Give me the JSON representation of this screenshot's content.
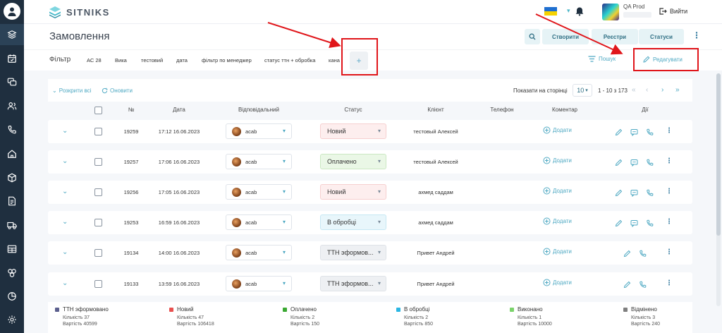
{
  "app": {
    "logo_text": "SITNIKS",
    "page_title": "Замовлення"
  },
  "user": {
    "name": "QA Prod",
    "logout_label": "Вийти"
  },
  "header_buttons": {
    "create": "Створити",
    "registers": "Реєстри",
    "statuses": "Статуси"
  },
  "filter": {
    "label": "Фільтр",
    "chips": [
      "АС 28",
      "Вика",
      "тестовий",
      "дата",
      "фільтр по менеджер",
      "статус ттн + обробка",
      "кана"
    ],
    "add_label": "+",
    "search_label": "Пошук",
    "edit_label": "Редагувати"
  },
  "toolbar": {
    "expand_all": "Розкрити всі",
    "refresh": "Оновити",
    "per_page_label": "Показати на сторінці",
    "per_page_value": "10",
    "range": "1 - 10 з 173"
  },
  "columns": {
    "number": "№",
    "date": "Дата",
    "responsible": "Відповідальний",
    "status": "Статус",
    "client": "Клієнт",
    "phone": "Телефон",
    "comment": "Коментар",
    "actions": "Дії"
  },
  "comment_add_label": "Додати",
  "rows": [
    {
      "id": "19259",
      "date": "17:12 16.06.2023",
      "responsible": "acab",
      "status": "Новий",
      "status_bg": "#fdeeee",
      "status_border": "#f6cfcf",
      "client": "тестовый Алексей",
      "has_chat": true
    },
    {
      "id": "19257",
      "date": "17:06 16.06.2023",
      "responsible": "acab",
      "status": "Оплачено",
      "status_bg": "#eaf7e6",
      "status_border": "#cbe8c3",
      "client": "тестовый Алексей",
      "has_chat": true
    },
    {
      "id": "19256",
      "date": "17:05 16.06.2023",
      "responsible": "acab",
      "status": "Новий",
      "status_bg": "#fdeeee",
      "status_border": "#f6cfcf",
      "client": "ахмед саддам",
      "has_chat": true
    },
    {
      "id": "19253",
      "date": "16:59 16.06.2023",
      "responsible": "acab",
      "status": "В обробці",
      "status_bg": "#e8f6fb",
      "status_border": "#c6e7f3",
      "client": "ахмед саддам",
      "has_chat": true
    },
    {
      "id": "19134",
      "date": "14:00 16.06.2023",
      "responsible": "acab",
      "status": "ТТН эформов...",
      "status_bg": "#eef0f3",
      "status_border": "#dfe3e8",
      "client": "Привет Андрей",
      "has_chat": false
    },
    {
      "id": "19133",
      "date": "13:59 16.06.2023",
      "responsible": "acab",
      "status": "ТТН эформов...",
      "status_bg": "#eef0f3",
      "status_border": "#dfe3e8",
      "client": "Привет Андрей",
      "has_chat": false
    }
  ],
  "summary": [
    {
      "name": "ТТН эформовано",
      "color": "#5b5f8e",
      "count": "Кількість 37",
      "value": "Вартість 40599"
    },
    {
      "name": "Новий",
      "color": "#e8504f",
      "count": "Кількість 47",
      "value": "Вартість 106418"
    },
    {
      "name": "Оплачено",
      "color": "#3aa832",
      "count": "Кількість 2",
      "value": "Вартість 150"
    },
    {
      "name": "В обробці",
      "color": "#2bb6e3",
      "count": "Кількість 2",
      "value": "Вартість 850"
    },
    {
      "name": "Виконано",
      "color": "#7bd36b",
      "count": "Кількість 1",
      "value": "Вартість 10000"
    },
    {
      "name": "Відмінено",
      "color": "#7f7f7f",
      "count": "Кількість 3",
      "value": "Вартість 240"
    }
  ]
}
